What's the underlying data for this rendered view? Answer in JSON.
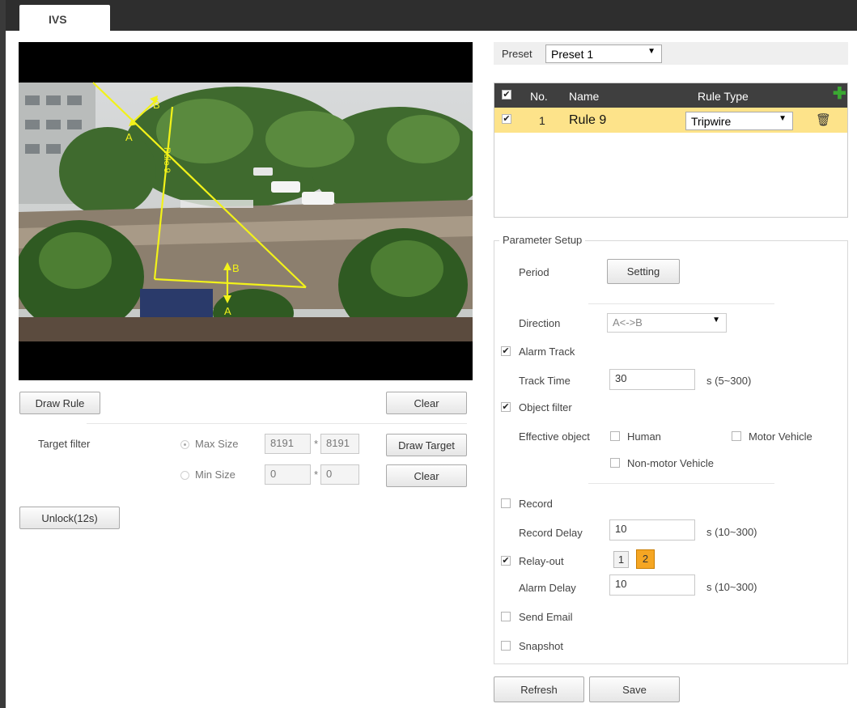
{
  "tab": {
    "label": "IVS"
  },
  "left": {
    "draw_rule": "Draw Rule",
    "clear": "Clear",
    "target_filter_label": "Target filter",
    "max_size_label": "Max Size",
    "max_w": "8191",
    "max_h": "8191",
    "min_size_label": "Min Size",
    "min_w": "0",
    "min_h": "0",
    "star": "*",
    "draw_target": "Draw Target",
    "clear2": "Clear",
    "unlock": "Unlock(12s)",
    "video_labels": {
      "a1": "A",
      "b1": "B",
      "a2": "A",
      "b2": "B",
      "rule_text": "Rule 9"
    }
  },
  "right": {
    "preset_label": "Preset",
    "preset_value": "Preset 1",
    "table": {
      "headers": {
        "no": "No.",
        "name": "Name",
        "type": "Rule Type"
      },
      "rows": [
        {
          "no": "1",
          "name": "Rule 9",
          "type": "Tripwire"
        }
      ]
    },
    "param_title": "Parameter Setup",
    "period_label": "Period",
    "setting_btn": "Setting",
    "direction_label": "Direction",
    "direction_value": "A<->B",
    "alarm_track": "Alarm Track",
    "track_time_label": "Track Time",
    "track_time_value": "30",
    "track_time_unit": "s (5~300)",
    "object_filter": "Object filter",
    "effective_object_label": "Effective object",
    "human": "Human",
    "motor_vehicle": "Motor Vehicle",
    "non_motor_vehicle": "Non-motor Vehicle",
    "record": "Record",
    "record_delay_label": "Record Delay",
    "record_delay_value": "10",
    "record_delay_unit": "s (10~300)",
    "relay_out": "Relay-out",
    "relay_1": "1",
    "relay_2": "2",
    "alarm_delay_label": "Alarm Delay",
    "alarm_delay_value": "10",
    "alarm_delay_unit": "s (10~300)",
    "send_email": "Send Email",
    "snapshot": "Snapshot",
    "refresh": "Refresh",
    "save": "Save"
  },
  "colors": {
    "rule_line": "#f2f21a",
    "selected_row": "#fde38a",
    "relay_active": "#f5a623",
    "add_icon": "#3aa832"
  }
}
